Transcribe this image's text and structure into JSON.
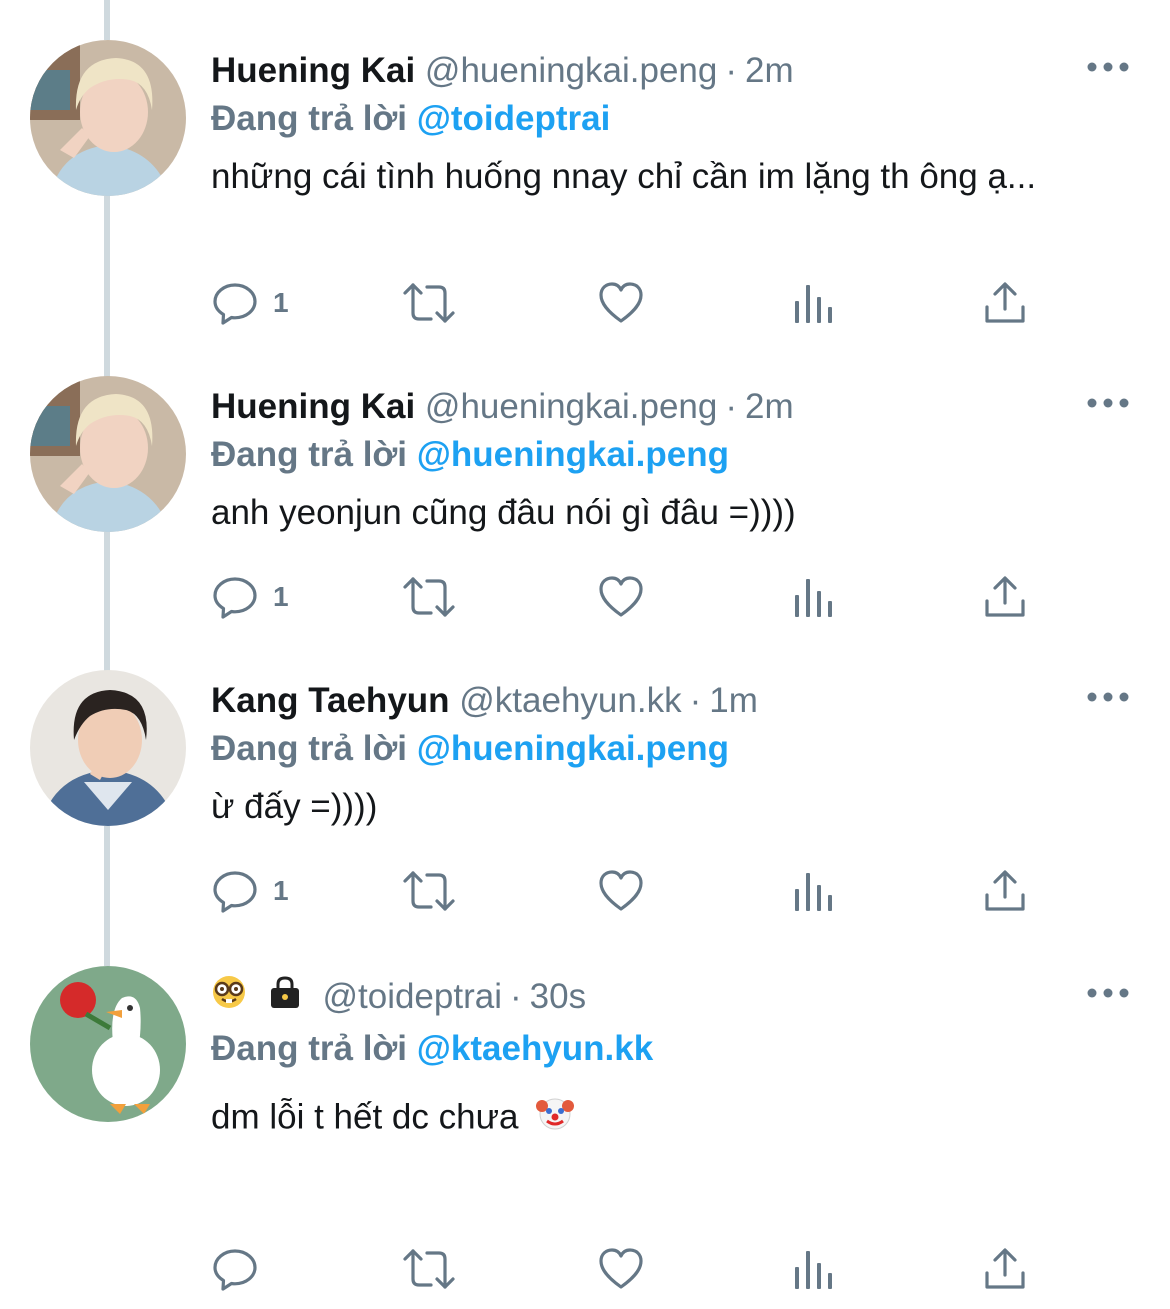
{
  "tweets": [
    {
      "display_name": "Huening Kai",
      "handle": "@hueningkai.peng",
      "dot": "·",
      "time": "2m",
      "reply_prefix": "Đang trả lời",
      "reply_to": "@toideptrai",
      "text": "những cái tình huống nnay chỉ cần im lặng th ông ạ...",
      "reply_count": "1",
      "avatar": "huening-kai-avatar"
    },
    {
      "display_name": "Huening Kai",
      "handle": "@hueningkai.peng",
      "dot": "·",
      "time": "2m",
      "reply_prefix": "Đang trả lời",
      "reply_to": "@hueningkai.peng",
      "text": "anh yeonjun cũng đâu nói gì đâu =))))",
      "reply_count": "1",
      "avatar": "huening-kai-avatar"
    },
    {
      "display_name": "Kang Taehyun",
      "handle": "@ktaehyun.kk",
      "dot": "·",
      "time": "1m",
      "reply_prefix": "Đang trả lời",
      "reply_to": "@hueningkai.peng",
      "text": "ừ đấy =))))",
      "reply_count": "1",
      "avatar": "kang-taehyun-avatar"
    },
    {
      "display_name_emojis": [
        "nerd-face-emoji",
        "locked-bag-emoji"
      ],
      "handle": "@toideptrai",
      "dot": "·",
      "time": "30s",
      "reply_prefix": "Đang trả lời",
      "reply_to": "@ktaehyun.kk",
      "text": "dm lỗi t hết dc chưa",
      "trailing_emoji": "clown-face-emoji",
      "reply_count": "",
      "avatar": "goose-avatar"
    }
  ],
  "icons": {
    "reply": "speech-bubble-icon",
    "retweet": "retweet-icon",
    "like": "heart-icon",
    "analytics": "bar-chart-icon",
    "share": "share-upload-icon",
    "more": "more-dots-icon"
  },
  "colors": {
    "accent": "#1da1f2",
    "secondary_text": "#657786",
    "primary_text": "#14171a",
    "thread_line": "#cfd9de"
  }
}
